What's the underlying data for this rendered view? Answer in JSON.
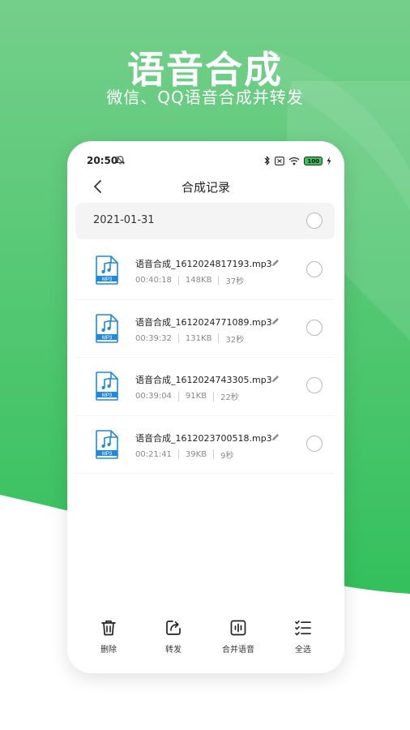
{
  "hero": {
    "title": "语音合成",
    "subtitle": "微信、QQ语音合成并转发"
  },
  "status_bar": {
    "time": "20:50",
    "battery": "100"
  },
  "header": {
    "title": "合成记录"
  },
  "group": {
    "date": "2021-01-31"
  },
  "files": [
    {
      "name": "语音合成_1612024817193.mp3",
      "time": "00:40:18",
      "size": "148KB",
      "duration": "37秒",
      "badge": "MP3"
    },
    {
      "name": "语音合成_1612024771089.mp3",
      "time": "00:39:32",
      "size": "131KB",
      "duration": "32秒",
      "badge": "MP3"
    },
    {
      "name": "语音合成_1612024743305.mp3",
      "time": "00:39:04",
      "size": "91KB",
      "duration": "22秒",
      "badge": "MP3"
    },
    {
      "name": "语音合成_1612023700518.mp3",
      "time": "00:21:41",
      "size": "39KB",
      "duration": "9秒",
      "badge": "MP3"
    }
  ],
  "toolbar": {
    "delete_label": "删除",
    "forward_label": "转发",
    "merge_label": "合并语音",
    "select_all_label": "全选"
  },
  "colors": {
    "brand_green": "#3cc261",
    "file_icon_blue": "#1f8ad8"
  }
}
